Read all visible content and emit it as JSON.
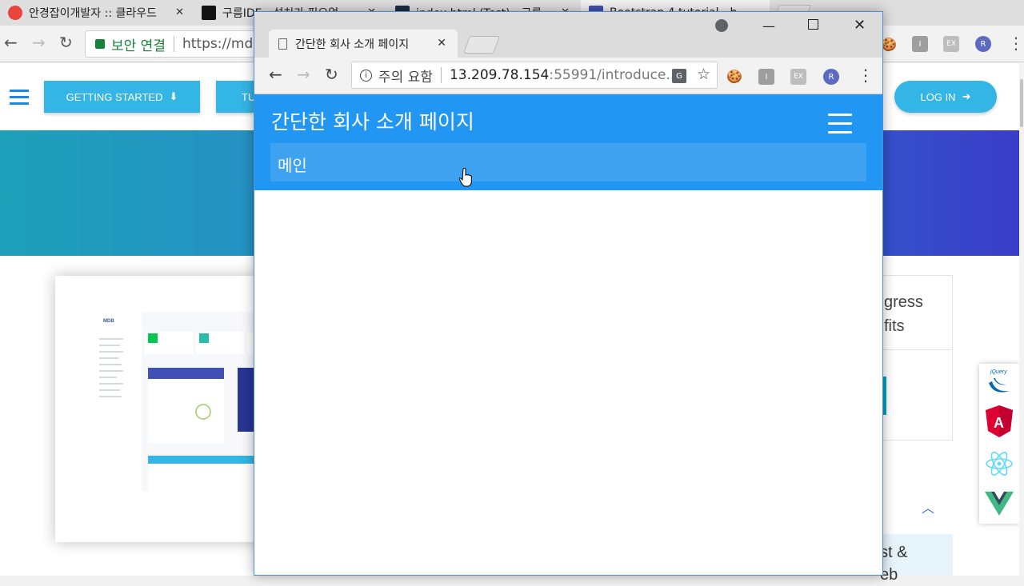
{
  "background_browser": {
    "tabs": [
      {
        "title": "안경잡이개발자 :: 클라우드",
        "favicon_color": "#e8453c"
      },
      {
        "title": "구름IDE - 설치가 필요없",
        "favicon_color": "#111111"
      },
      {
        "title": "index.html (Test) - 구름",
        "favicon_color": "#1c2b44"
      },
      {
        "title": "Bootstrap 4 tutorial - b",
        "favicon_color": "#3f51b5"
      }
    ],
    "omnibox": {
      "secure_label": "보안 연결",
      "url": "https://md"
    },
    "extensions": [
      {
        "icon": "cookie-icon",
        "label": "🍪",
        "color": "#b8865b"
      },
      {
        "icon": "i-ext-icon",
        "label": "I",
        "color": "#9e9e9e"
      },
      {
        "icon": "ex-ext-icon",
        "label": "EX",
        "color": "#bdbdbd"
      },
      {
        "icon": "r-ext-icon",
        "label": "R",
        "color": "#5c6bc0"
      }
    ],
    "page": {
      "nav_buttons": [
        "GETTING STARTED",
        "TU"
      ],
      "login_label": "LOG IN",
      "right_card_text": [
        "gress",
        "fits"
      ],
      "bottom_card_text": [
        "st &",
        "eb"
      ],
      "side_icons": [
        "jquery-icon",
        "angular-icon",
        "react-icon",
        "vue-icon"
      ]
    }
  },
  "foreground_browser": {
    "tab_title": "간단한 회사 소개 페이지",
    "omnibox": {
      "warning_label": "주의 요함",
      "host": "13.209.78.154",
      "path": ":55991/introduce..."
    },
    "site": {
      "brand": "간단한 회사 소개 페이지",
      "menu_items": [
        "메인"
      ],
      "navbar_color": "#2196f3"
    }
  }
}
